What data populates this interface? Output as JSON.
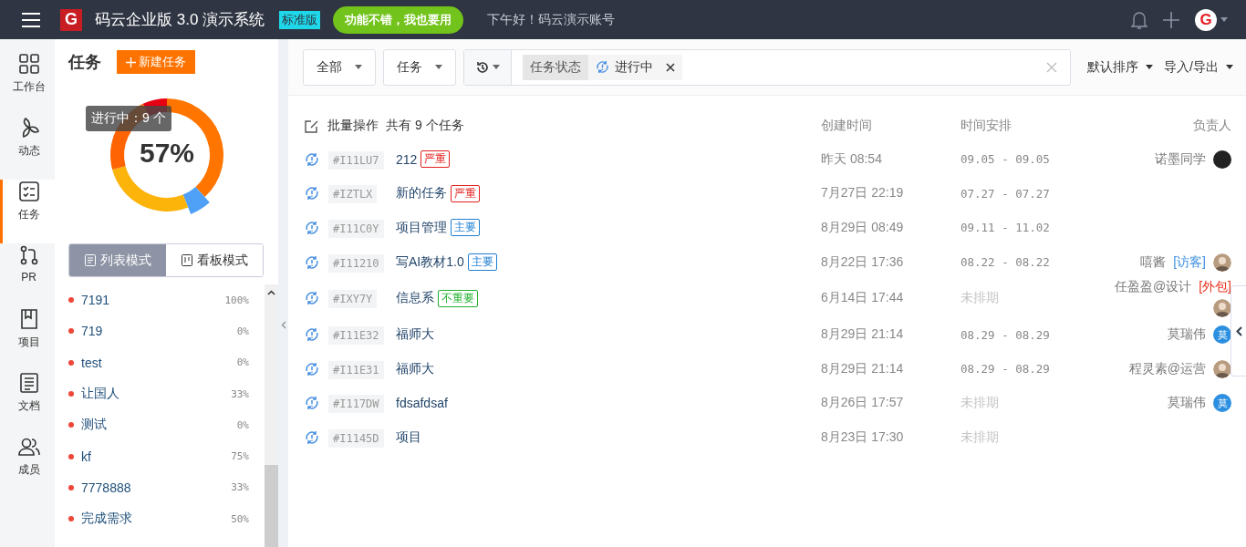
{
  "topbar": {
    "logo_letter": "G",
    "title": "码云企业版 3.0 演示系统",
    "edition_badge": "标准版",
    "promo_button": "功能不错，我也要用",
    "greeting": "下午好！码云演示账号",
    "avatar_letter": "G"
  },
  "nav": [
    {
      "label": "工作台",
      "selected": false
    },
    {
      "label": "动态",
      "selected": false
    },
    {
      "label": "任务",
      "selected": true
    },
    {
      "label": "PR",
      "selected": false
    },
    {
      "label": "项目",
      "selected": false
    },
    {
      "label": "文档",
      "selected": false
    },
    {
      "label": "成员",
      "selected": false
    }
  ],
  "panel": {
    "title": "任务",
    "new_button": "新建任务",
    "donut_center": "57%",
    "tooltip": "进行中：9 个",
    "view_modes": [
      {
        "label": "列表模式",
        "selected": true
      },
      {
        "label": "看板模式",
        "selected": false
      }
    ],
    "projects": [
      {
        "name": "7191",
        "percent": "100%"
      },
      {
        "name": "719",
        "percent": "0%"
      },
      {
        "name": "test",
        "percent": "0%"
      },
      {
        "name": "让国人",
        "percent": "33%"
      },
      {
        "name": "测试",
        "percent": "0%"
      },
      {
        "name": "kf",
        "percent": "75%"
      },
      {
        "name": "7778888",
        "percent": "33%"
      },
      {
        "name": "完成需求",
        "percent": "50%"
      }
    ]
  },
  "filters": {
    "scope": "全部",
    "type": "任务",
    "chip_label": "任务状态",
    "chip_value": "进行中",
    "sort": "默认排序",
    "import_export": "导入/导出"
  },
  "table": {
    "batch": "批量操作",
    "count": "共有 9 个任务",
    "columns": [
      "创建时间",
      "时间安排",
      "负责人"
    ],
    "rows": [
      {
        "id": "#I11LU7",
        "title": "212",
        "tag": {
          "text": "严重",
          "kind": "critical"
        },
        "created": "昨天 08:54",
        "schedule": "09.05 - 09.05",
        "scheduled": true,
        "assignee": "诺墨同学",
        "avatar": {
          "kind": "dark"
        }
      },
      {
        "id": "#IZTLX",
        "title": "新的任务",
        "tag": {
          "text": "严重",
          "kind": "critical"
        },
        "created": "7月27日 22:19",
        "schedule": "07.27 - 07.27",
        "scheduled": true
      },
      {
        "id": "#I11C0Y",
        "title": "项目管理",
        "tag": {
          "text": "主要",
          "kind": "major"
        },
        "created": "8月29日 08:49",
        "schedule": "09.11 - 11.02",
        "scheduled": true
      },
      {
        "id": "#I11210",
        "title": "写AI教材1.0",
        "tag": {
          "text": "主要",
          "kind": "major"
        },
        "created": "8月22日 17:36",
        "schedule": "08.22 - 08.22",
        "scheduled": true,
        "assignee": "嘻酱",
        "role": {
          "text": "[访客]",
          "kind": "guest"
        },
        "avatar": {
          "kind": "photo"
        }
      },
      {
        "id": "#IXY7Y",
        "title": "信息系",
        "tag": {
          "text": "不重要",
          "kind": "minor"
        },
        "created": "6月14日 17:44",
        "schedule": "未排期",
        "scheduled": false,
        "assignee": "任盈盈@设计",
        "role": {
          "text": "[外包]",
          "kind": "outsource"
        },
        "avatar": {
          "kind": "photo"
        }
      },
      {
        "id": "#I11E32",
        "title": "福师大",
        "created": "8月29日 21:14",
        "schedule": "08.29 - 08.29",
        "scheduled": true,
        "assignee": "莫瑞伟",
        "avatar": {
          "kind": "letter",
          "letter": "莫"
        }
      },
      {
        "id": "#I11E31",
        "title": "福师大",
        "created": "8月29日 21:14",
        "schedule": "08.29 - 08.29",
        "scheduled": true,
        "assignee": "程灵素@运营",
        "avatar": {
          "kind": "photo"
        }
      },
      {
        "id": "#I117DW",
        "title": "fdsafdsaf",
        "created": "8月26日 17:57",
        "schedule": "未排期",
        "scheduled": false,
        "assignee": "莫瑞伟",
        "avatar": {
          "kind": "letter",
          "letter": "莫"
        }
      },
      {
        "id": "#I1145D",
        "title": "项目",
        "created": "8月23日 17:30",
        "schedule": "未排期",
        "scheduled": false
      }
    ]
  }
}
